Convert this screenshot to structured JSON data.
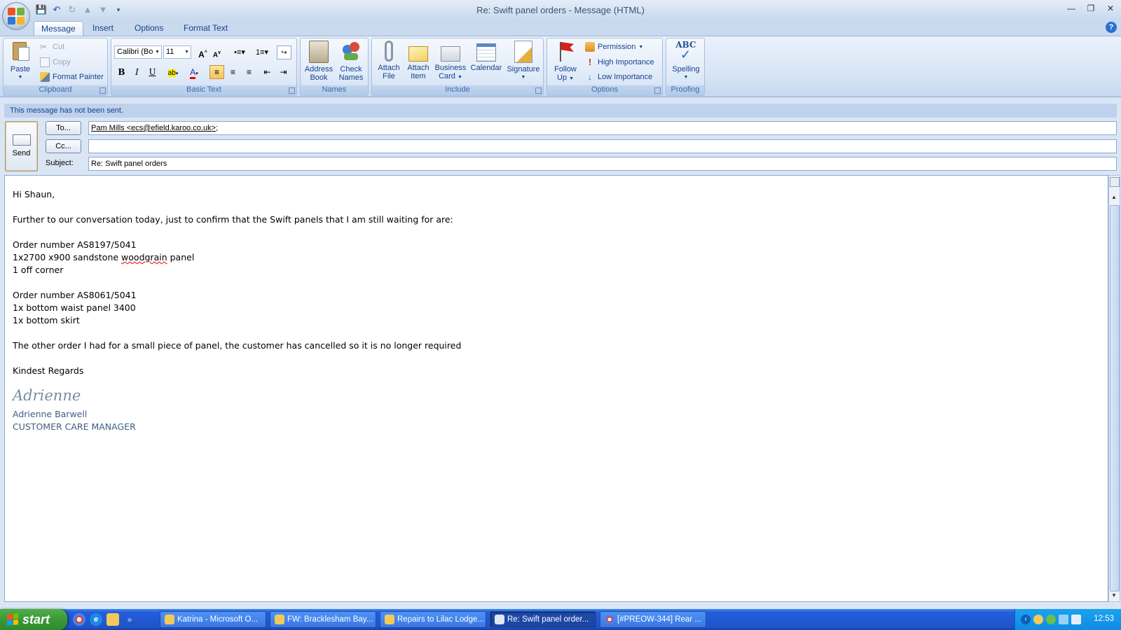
{
  "window": {
    "title": "Re: Swift panel orders - Message (HTML)",
    "controls": [
      "minimize",
      "restore",
      "close"
    ]
  },
  "quick_access": [
    "save-icon",
    "undo-icon",
    "redo-icon",
    "previous-icon",
    "next-icon",
    "customize-icon"
  ],
  "tabs": [
    {
      "label": "Message",
      "active": true
    },
    {
      "label": "Insert",
      "active": false
    },
    {
      "label": "Options",
      "active": false
    },
    {
      "label": "Format Text",
      "active": false
    }
  ],
  "ribbon": {
    "clipboard": {
      "label": "Clipboard",
      "paste": "Paste",
      "cut": "Cut",
      "copy": "Copy",
      "format_painter": "Format Painter"
    },
    "basic_text": {
      "label": "Basic Text",
      "font": "Calibri (Bo",
      "size": "11",
      "bold": "B",
      "italic": "I",
      "underline": "U"
    },
    "names": {
      "label": "Names",
      "address_book_1": "Address",
      "address_book_2": "Book",
      "check_names_1": "Check",
      "check_names_2": "Names"
    },
    "include": {
      "label": "Include",
      "attach_file_1": "Attach",
      "attach_file_2": "File",
      "attach_item_1": "Attach",
      "attach_item_2": "Item",
      "business_card_1": "Business",
      "business_card_2": "Card",
      "calendar": "Calendar",
      "signature": "Signature"
    },
    "options": {
      "label": "Options",
      "follow_up_1": "Follow",
      "follow_up_2": "Up",
      "permission": "Permission",
      "high_importance": "High Importance",
      "low_importance": "Low Importance"
    },
    "proofing": {
      "label": "Proofing",
      "spelling": "Spelling",
      "abc": "ABC"
    }
  },
  "infobar": "This message has not been sent.",
  "header": {
    "send": "Send",
    "to_button": "To...",
    "cc_button": "Cc...",
    "subject_label": "Subject:",
    "to_value": "Pam Mills <ecs@efield.karoo.co.uk>",
    "to_suffix": ";",
    "cc_value": "",
    "subject_value": "Re: Swift panel orders"
  },
  "body": {
    "greeting": "Hi Shaun,",
    "intro": "Further to our conversation today, just to confirm that the Swift panels that I am still waiting for are:",
    "order1_number": "Order number AS8197/5041",
    "order1_line1_a": "1x2700 x900 sandstone ",
    "order1_line1_b": "woodgrain",
    "order1_line1_c": " panel",
    "order1_line2": "1 off corner",
    "order2_number": "Order number AS8061/5041",
    "order2_line1": "1x bottom waist panel 3400",
    "order2_line2": "1x bottom skirt",
    "other_order": "The other order I had for a small piece of panel, the customer has cancelled so it is no longer required",
    "closing": "Kindest Regards",
    "signature_script": "Adrienne",
    "sig_name": "Adrienne Barwell",
    "sig_title": "CUSTOMER CARE MANAGER"
  },
  "taskbar": {
    "start": "start",
    "tasks": [
      {
        "label": "Katrina - Microsoft O...",
        "active": false
      },
      {
        "label": "FW: Bracklesham Bay...",
        "active": false
      },
      {
        "label": "Repairs to Lilac Lodge...",
        "active": false
      },
      {
        "label": "Re: Swift panel order...",
        "active": true
      },
      {
        "label": "[#PREOW-344] Rear ...",
        "active": false
      }
    ],
    "clock": "12:53"
  }
}
